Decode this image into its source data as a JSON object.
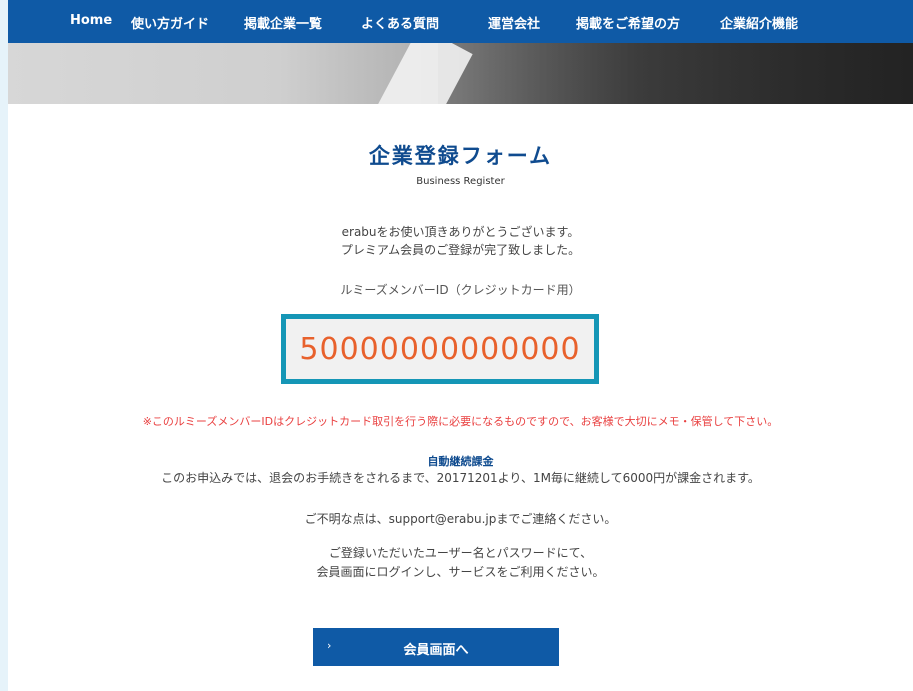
{
  "nav": {
    "items": [
      "Home",
      "使い方ガイド",
      "掲載企業一覧",
      "よくある質問",
      "運営会社",
      "掲載をご希望の方",
      "企業紹介機能"
    ]
  },
  "form": {
    "title": "企業登録フォーム",
    "subtitle": "Business Register",
    "thanks_line1": "erabuをお使い頂きありがとうございます。",
    "thanks_line2": "プレミアム会員のご登録が完了致しました。",
    "member_label": "ルミーズメンバーID（クレジットカード用）",
    "member_id": "50000000000000",
    "notice": "※このルミーズメンバーIDはクレジットカード取引を行う際に必要になるものですので、お客様で大切にメモ・保管して下さい。",
    "billing_title": "自動継続課金",
    "billing_text": "このお申込みでは、退会のお手続きをされるまで、20171201より、1M毎に継続して6000円が課金されます。",
    "contact_text": "ご不明な点は、support@erabu.jpまでご連絡ください。",
    "login_line1": "ご登録いただいたユーザー名とパスワードにて、",
    "login_line2": "会員画面にログインし、サービスをご利用ください。",
    "cta_chevron": "›",
    "cta_label": "会員画面へ"
  },
  "colors": {
    "nav_bg": "#0f5aa6",
    "title": "#0f4b8f",
    "id_border": "#1596b6",
    "id_text": "#e8612c",
    "notice": "#e94040"
  }
}
